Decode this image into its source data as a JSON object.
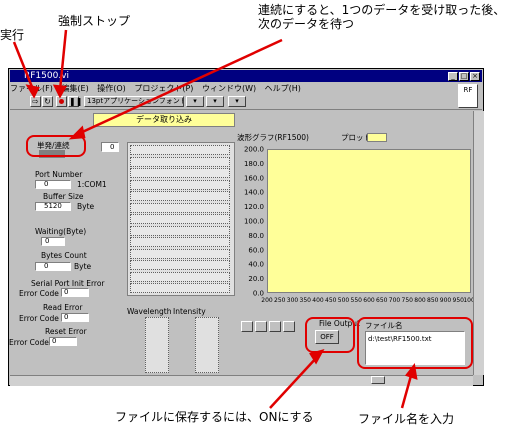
{
  "annotations": {
    "run": "実行",
    "force_stop": "強制ストップ",
    "continuous": "連続にすると、1つのデータを受け取った後、",
    "continuous2": "次のデータを待つ",
    "save_on": "ファイルに保存するには、ONにする",
    "file_name": "ファイル名を入力"
  },
  "window": {
    "title": "RF1500.vi",
    "menu": [
      "ファイル(F)",
      "編集(E)",
      "操作(O)",
      "プロジェクト(P)",
      "ウィンドウ(W)",
      "ヘルプ(H)"
    ],
    "font_select": "13ptアプリケーションフォント",
    "banner": "データ取り込み"
  },
  "controls": {
    "mode_label": "単発/連続",
    "port_number_label": "Port Number",
    "port_number_value": "0",
    "port_number_unit": "1:COM1",
    "buffer_size_label": "Buffer Size",
    "buffer_size_value": "5120",
    "buffer_size_unit": "Byte",
    "waiting_label": "Waiting(Byte)",
    "waiting_value": "0",
    "bytes_count_label": "Bytes Count",
    "bytes_count_value": "0",
    "bytes_count_unit": "Byte",
    "serial_error_label": "Serial Port Init Error",
    "error_code_label1": "Error Code",
    "error_code_value1": "0",
    "read_error_label": "Read Error",
    "error_code_label2": "Error Code",
    "error_code_value2": "0",
    "reset_error_label": "Reset Error",
    "error_code_label3": "Error Code",
    "error_code_value3": "0",
    "array_index": "0",
    "wavelength_label": "Wavelength",
    "intensity_label": "Intensity",
    "file_output_label": "File Output",
    "file_output_value": "OFF",
    "file_name_label": "ファイル名",
    "file_name_value": "d:\\test\\RF1500.txt"
  },
  "chart_data": {
    "type": "line",
    "title": "波形グラフ(RF1500)",
    "legend": "プロット 0",
    "ylim": [
      0,
      200
    ],
    "yticks": [
      0,
      20,
      40,
      60,
      80,
      100,
      120,
      140,
      160,
      180,
      200
    ],
    "xlim": [
      200,
      1000
    ],
    "xticks": [
      200,
      250,
      300,
      350,
      400,
      450,
      500,
      550,
      600,
      650,
      700,
      750,
      800,
      850,
      900,
      950,
      1000
    ],
    "series": []
  },
  "colors": {
    "annotation": "#e00000",
    "plot_bg": "#ffff99",
    "banner_bg": "#ffff99"
  }
}
